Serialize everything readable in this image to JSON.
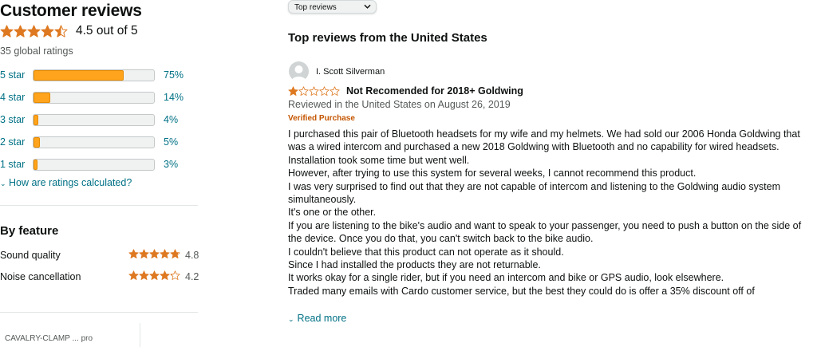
{
  "summary": {
    "title": "Customer reviews",
    "average_text": "4.5 out of 5",
    "average_value": 4.5,
    "global_ratings": "35 global ratings",
    "histogram": [
      {
        "label": "5 star",
        "pct": "75%",
        "value": 75
      },
      {
        "label": "4 star",
        "pct": "14%",
        "value": 14
      },
      {
        "label": "3 star",
        "pct": "4%",
        "value": 4
      },
      {
        "label": "2 star",
        "pct": "5%",
        "value": 5
      },
      {
        "label": "1 star",
        "pct": "3%",
        "value": 3
      }
    ],
    "how_calculated": "How are ratings calculated?"
  },
  "features": {
    "title": "By feature",
    "items": [
      {
        "name": "Sound quality",
        "value": "4.8",
        "rating": 4.8
      },
      {
        "name": "Noise cancellation",
        "value": "4.2",
        "rating": 4.2
      }
    ]
  },
  "bottom_tab": {
    "label": "CAVALRY-CLAMP ... pro"
  },
  "sort": {
    "selected": "Top reviews"
  },
  "reviews_section": {
    "title": "Top reviews from the United States"
  },
  "review": {
    "author": "I. Scott Silverman",
    "rating": 1,
    "title": "Not Recomended for 2018+ Goldwing",
    "date": "Reviewed in the United States on August 26, 2019",
    "verified": "Verified Purchase",
    "body": [
      "I purchased this pair of Bluetooth headsets for my wife and my helmets. We had sold our 2006 Honda Goldwing that was a wired intercom and purchased a new 2018 Goldwing with Bluetooth and no capability for wired headsets.",
      "Installation took some time but went well.",
      "However, after trying to use this system for several weeks, I cannot recommend this product.",
      "I was very surprised to find out that they are not capable of intercom and listening to the Goldwing audio system simultaneously.",
      "It's one or the other.",
      "If you are listening to the bike's audio and want to speak to your passenger, you need to push a button on the side of the device. Once you do that, you can't switch back to the bike audio.",
      "I couldn't believe that this product can not operate as it should.",
      "Since I had installed the products they are not returnable.",
      "It works okay for a single rider, but if you need an intercom and bike or GPS audio, look elsewhere.",
      "Traded many emails with Cardo customer service, but the best they could do is offer a 35% discount off of"
    ],
    "read_more": "Read more"
  },
  "colors": {
    "star": "#de7921",
    "star_empty_stroke": "#de7921",
    "bar_fill": "#ffa41c",
    "link": "#007185",
    "verified": "#c45500"
  }
}
